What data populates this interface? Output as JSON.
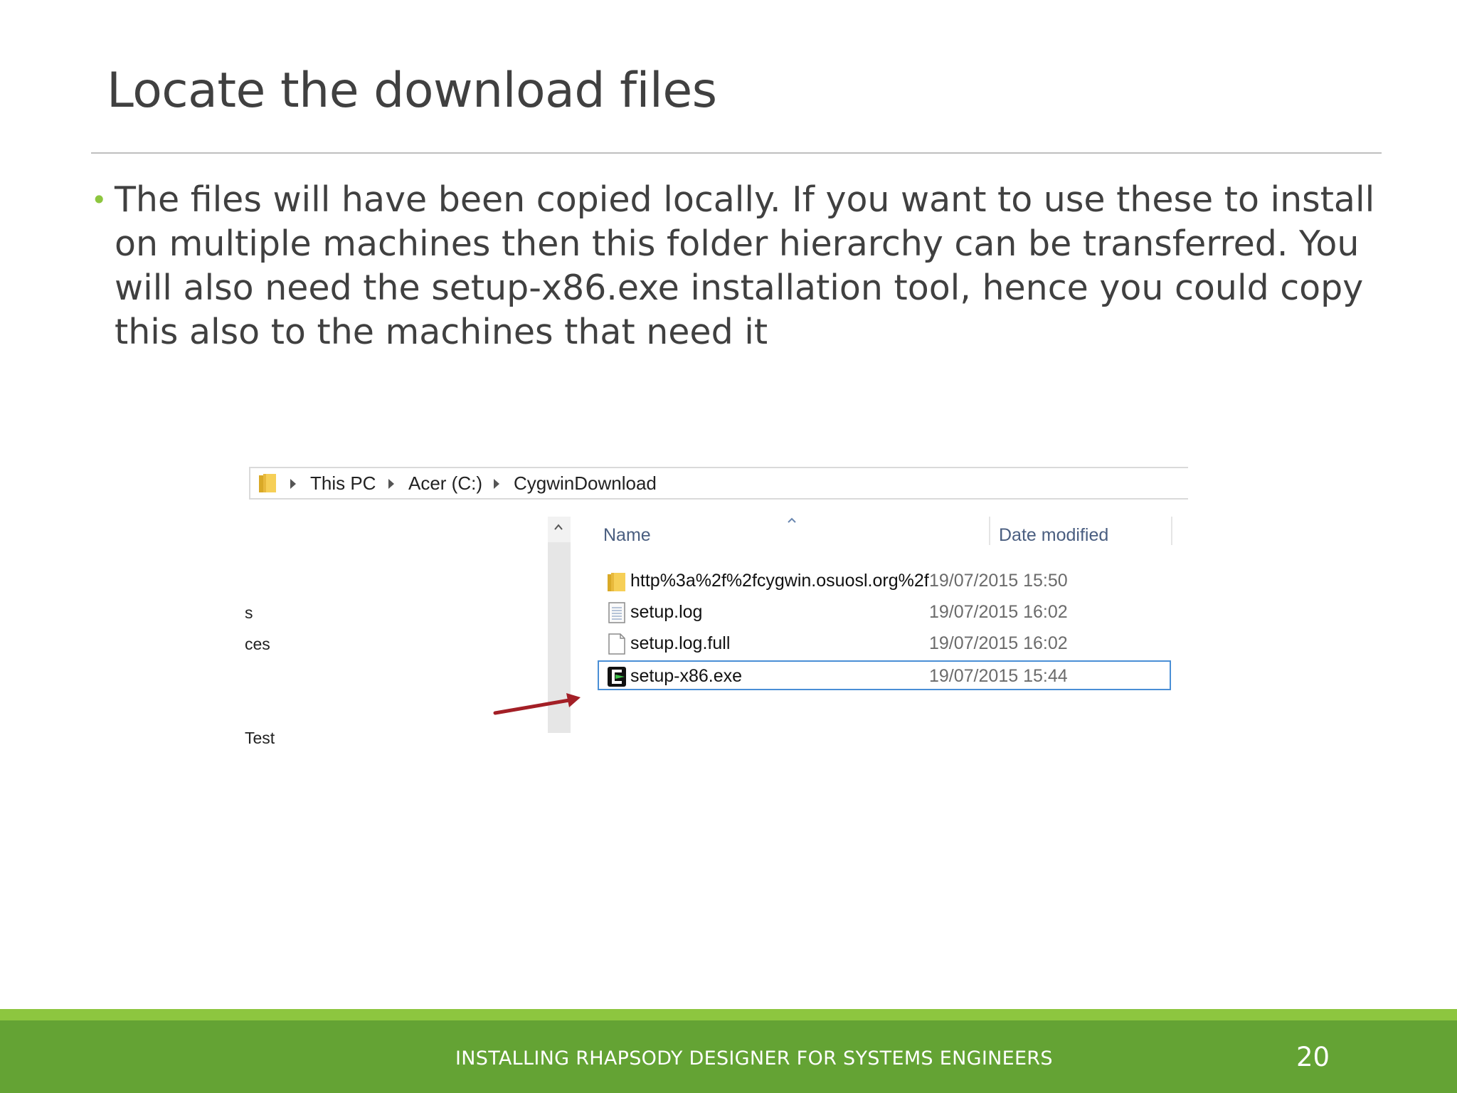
{
  "slide": {
    "title": "Locate the download files",
    "bullet": "The files will have been copied locally. If you want to use these to install on multiple machines then this folder hierarchy can be transferred. You will also need the setup-x86.exe installation tool, hence you could copy this also to the machines that need it",
    "footer": "INSTALLING RHAPSODY DESIGNER FOR SYSTEMS ENGINEERS",
    "page_number": "20"
  },
  "explorer": {
    "breadcrumb": [
      "This PC",
      "Acer (C:)",
      "CygwinDownload"
    ],
    "nav_fragments": [
      "s",
      "ces",
      "Test"
    ],
    "columns": {
      "name": "Name",
      "date": "Date modified"
    },
    "files": [
      {
        "name": "http%3a%2f%2fcygwin.osuosl.org%2f",
        "date": "19/07/2015 15:50",
        "icon": "folder-icon"
      },
      {
        "name": "setup.log",
        "date": "19/07/2015 16:02",
        "icon": "text-file-icon"
      },
      {
        "name": "setup.log.full",
        "date": "19/07/2015 16:02",
        "icon": "file-icon"
      },
      {
        "name": "setup-x86.exe",
        "date": "19/07/2015 15:44",
        "icon": "cygwin-setup-icon",
        "selected": true
      }
    ]
  },
  "colors": {
    "accent_green": "#8dc63f",
    "footer_green": "#64a334",
    "selection_blue": "#4a8fd6",
    "arrow_red": "#a31f26"
  }
}
